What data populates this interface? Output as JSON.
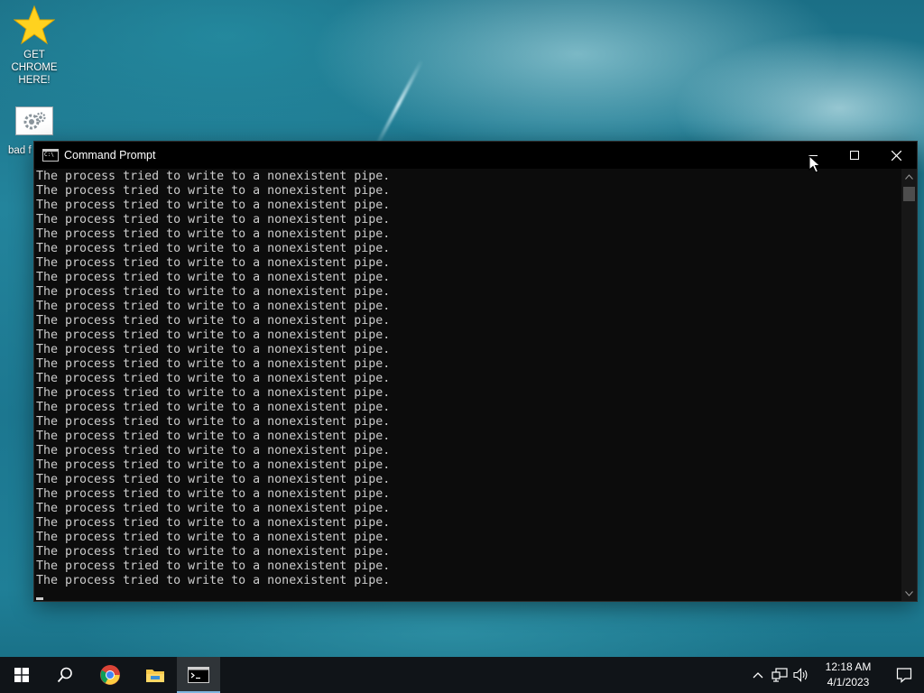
{
  "desktop": {
    "icons": [
      {
        "label": "GET CHROME HERE!",
        "icon": "star-icon"
      },
      {
        "label": "bad f",
        "icon": "settings-file-icon"
      }
    ]
  },
  "window": {
    "title": "Command Prompt",
    "app_icon": "cmd-icon",
    "controls": {
      "minimize": "minimize-icon",
      "maximize": "maximize-icon",
      "close": "close-icon"
    },
    "console_lines": [
      "The process tried to write to a nonexistent pipe.",
      "The process tried to write to a nonexistent pipe.",
      "The process tried to write to a nonexistent pipe.",
      "The process tried to write to a nonexistent pipe.",
      "The process tried to write to a nonexistent pipe.",
      "The process tried to write to a nonexistent pipe.",
      "The process tried to write to a nonexistent pipe.",
      "The process tried to write to a nonexistent pipe.",
      "The process tried to write to a nonexistent pipe.",
      "The process tried to write to a nonexistent pipe.",
      "The process tried to write to a nonexistent pipe.",
      "The process tried to write to a nonexistent pipe.",
      "The process tried to write to a nonexistent pipe.",
      "The process tried to write to a nonexistent pipe.",
      "The process tried to write to a nonexistent pipe.",
      "The process tried to write to a nonexistent pipe.",
      "The process tried to write to a nonexistent pipe.",
      "The process tried to write to a nonexistent pipe.",
      "The process tried to write to a nonexistent pipe.",
      "The process tried to write to a nonexistent pipe.",
      "The process tried to write to a nonexistent pipe.",
      "The process tried to write to a nonexistent pipe.",
      "The process tried to write to a nonexistent pipe.",
      "The process tried to write to a nonexistent pipe.",
      "The process tried to write to a nonexistent pipe.",
      "The process tried to write to a nonexistent pipe.",
      "The process tried to write to a nonexistent pipe.",
      "The process tried to write to a nonexistent pipe.",
      "The process tried to write to a nonexistent pipe."
    ]
  },
  "taskbar": {
    "buttons": [
      "windows-start-icon",
      "search-icon",
      "chrome-icon",
      "file-explorer-icon",
      "cmd-icon"
    ],
    "tray_icons": [
      "chevron-up-icon",
      "network-icon",
      "volume-icon"
    ],
    "clock": {
      "time": "12:18 AM",
      "date": "4/1/2023"
    },
    "notification_icon": "notification-icon"
  },
  "colors": {
    "console_bg": "#0c0c0c",
    "console_text": "#cccccc",
    "taskbar_bg": "#101418",
    "active_accent": "#7fb6e0"
  }
}
